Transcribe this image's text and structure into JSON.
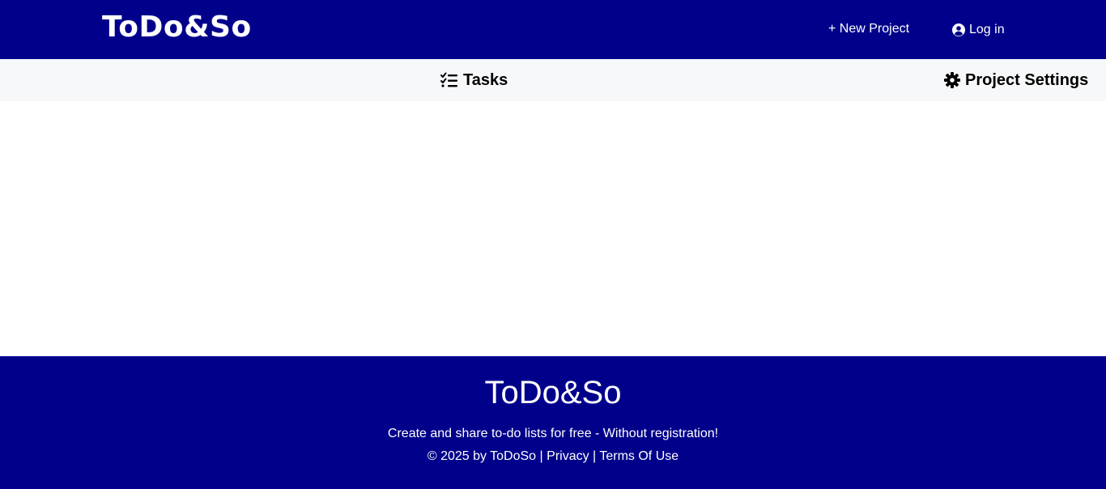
{
  "header": {
    "logo": "ToDo&So",
    "new_project": "+ New Project",
    "login": "Log in",
    "login_icon": "user-circle-icon"
  },
  "subnav": {
    "tasks": {
      "label": "Tasks",
      "icon": "checklist-icon"
    },
    "settings": {
      "label": "Project Settings",
      "icon": "gear-icon"
    }
  },
  "footer": {
    "title": "ToDo&So",
    "tagline": "Create and share to-do lists for free - Without registration!",
    "copyright": "© 2025 by ToDoSo",
    "separator": "|",
    "privacy": "Privacy",
    "terms": "Terms Of Use"
  },
  "colors": {
    "brand": "#00008b",
    "subnav_bg": "#f7f8fa"
  }
}
